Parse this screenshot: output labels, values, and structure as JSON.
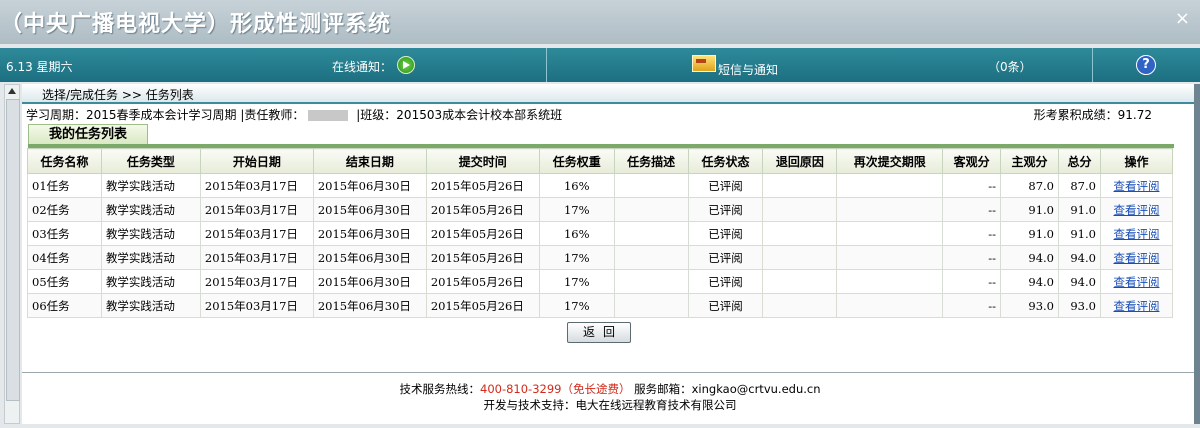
{
  "window": {
    "title": "（中央广播电视大学）形成性测评系统",
    "close_symbol": "×"
  },
  "topbar": {
    "date": "6.13 星期六",
    "online_notice_label": "在线通知：",
    "sms_label": "短信与通知",
    "sms_count": "（0条）",
    "help_symbol": "?"
  },
  "breadcrumb": "选择/完成任务 >> 任务列表",
  "meta": {
    "study_period": "学习周期：2015春季成本会计学习周期",
    "teacher_label": "|责任教师：",
    "class_text": "|班级：201503成本会计校本部系统班",
    "cumulative_score": "形考累积成绩：91.72"
  },
  "section_title": "我的任务列表",
  "table": {
    "headers": [
      "任务名称",
      "任务类型",
      "开始日期",
      "结束日期",
      "提交时间",
      "任务权重",
      "任务描述",
      "任务状态",
      "退回原因",
      "再次提交期限",
      "客观分",
      "主观分",
      "总分",
      "操作"
    ],
    "rows": [
      {
        "name": "01任务",
        "type": "教学实践活动",
        "start": "2015年03月17日",
        "end": "2015年06月30日",
        "submit": "2015年05月26日",
        "weight": "16%",
        "desc": "",
        "status": "已评阅",
        "reason": "",
        "deadline": "",
        "objective": "--",
        "subjective": "87.0",
        "total": "87.0",
        "action": "查看评阅"
      },
      {
        "name": "02任务",
        "type": "教学实践活动",
        "start": "2015年03月17日",
        "end": "2015年06月30日",
        "submit": "2015年05月26日",
        "weight": "17%",
        "desc": "",
        "status": "已评阅",
        "reason": "",
        "deadline": "",
        "objective": "--",
        "subjective": "91.0",
        "total": "91.0",
        "action": "查看评阅"
      },
      {
        "name": "03任务",
        "type": "教学实践活动",
        "start": "2015年03月17日",
        "end": "2015年06月30日",
        "submit": "2015年05月26日",
        "weight": "16%",
        "desc": "",
        "status": "已评阅",
        "reason": "",
        "deadline": "",
        "objective": "--",
        "subjective": "91.0",
        "total": "91.0",
        "action": "查看评阅"
      },
      {
        "name": "04任务",
        "type": "教学实践活动",
        "start": "2015年03月17日",
        "end": "2015年06月30日",
        "submit": "2015年05月26日",
        "weight": "17%",
        "desc": "",
        "status": "已评阅",
        "reason": "",
        "deadline": "",
        "objective": "--",
        "subjective": "94.0",
        "total": "94.0",
        "action": "查看评阅"
      },
      {
        "name": "05任务",
        "type": "教学实践活动",
        "start": "2015年03月17日",
        "end": "2015年06月30日",
        "submit": "2015年05月26日",
        "weight": "17%",
        "desc": "",
        "status": "已评阅",
        "reason": "",
        "deadline": "",
        "objective": "--",
        "subjective": "94.0",
        "total": "94.0",
        "action": "查看评阅"
      },
      {
        "name": "06任务",
        "type": "教学实践活动",
        "start": "2015年03月17日",
        "end": "2015年06月30日",
        "submit": "2015年05月26日",
        "weight": "17%",
        "desc": "",
        "status": "已评阅",
        "reason": "",
        "deadline": "",
        "objective": "--",
        "subjective": "93.0",
        "total": "93.0",
        "action": "查看评阅"
      }
    ]
  },
  "back_button": "返回",
  "footer": {
    "hotline_label": "技术服务热线：",
    "hotline": "400-810-3299（免长途费）",
    "email": "服务邮箱：xingkao@crtvu.edu.cn",
    "support": "开发与技术支持：电大在线远程教育技术有限公司"
  },
  "colors": {
    "topbar": "#1c6f80",
    "link": "#1a4fb5",
    "hotline": "#d12a1a",
    "section": "#7aa96a"
  }
}
